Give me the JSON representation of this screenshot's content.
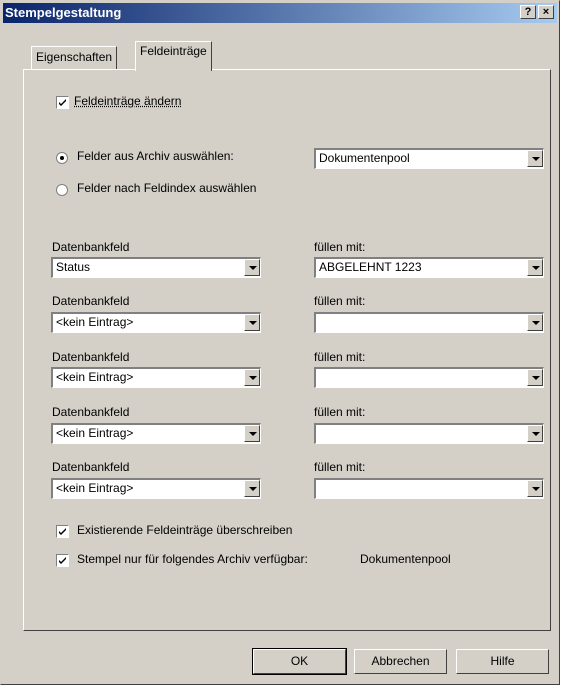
{
  "window": {
    "title": "Stempelgestaltung",
    "help_btn": "?",
    "close_btn": "×"
  },
  "tabs": [
    {
      "label": "Eigenschaften"
    },
    {
      "label": "Feldeinträge"
    }
  ],
  "edit_fields": {
    "label": "Feldeinträge ändern",
    "checked": true
  },
  "source": {
    "from_archive_label": "Felder aus Archiv auswählen:",
    "by_index_label": "Felder nach Feldindex auswählen",
    "archive_value": "Dokumentenpool"
  },
  "field_rows": [
    {
      "db_label": "Datenbankfeld",
      "db_value": "Status",
      "fill_label": "füllen mit:",
      "fill_value": "ABGELEHNT 1223"
    },
    {
      "db_label": "Datenbankfeld",
      "db_value": "<kein Eintrag>",
      "fill_label": "füllen mit:",
      "fill_value": ""
    },
    {
      "db_label": "Datenbankfeld",
      "db_value": "<kein Eintrag>",
      "fill_label": "füllen mit:",
      "fill_value": ""
    },
    {
      "db_label": "Datenbankfeld",
      "db_value": "<kein Eintrag>",
      "fill_label": "füllen mit:",
      "fill_value": ""
    },
    {
      "db_label": "Datenbankfeld",
      "db_value": "<kein Eintrag>",
      "fill_label": "füllen mit:",
      "fill_value": ""
    }
  ],
  "options": {
    "overwrite_label": "Existierende Feldeinträge überschreiben",
    "only_archive_label": "Stempel nur für folgendes Archiv verfügbar:",
    "only_archive_value": "Dokumentenpool"
  },
  "buttons": {
    "ok": "OK",
    "cancel": "Abbrechen",
    "help": "Hilfe"
  }
}
